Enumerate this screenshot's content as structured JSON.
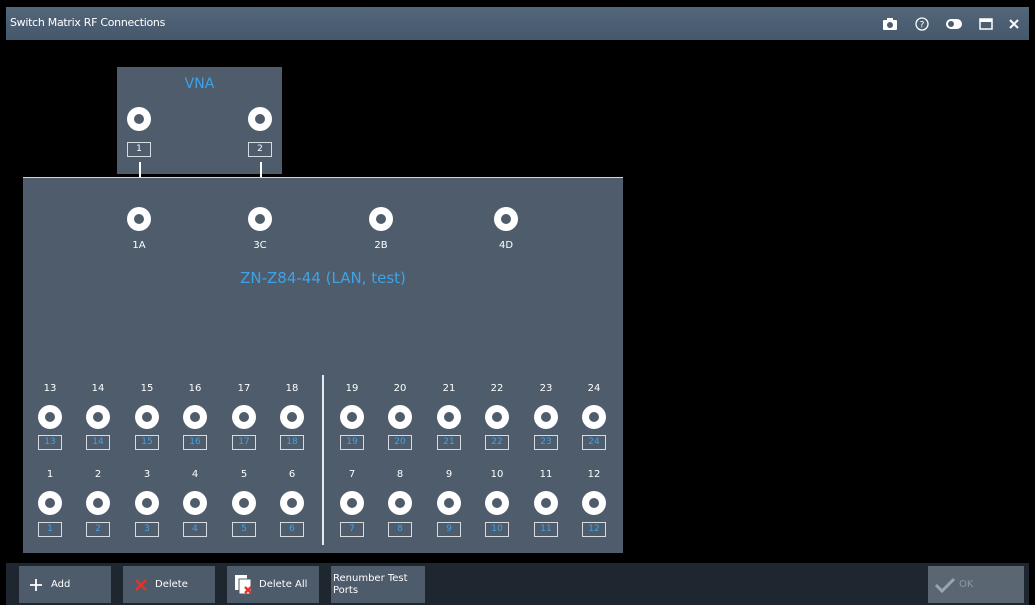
{
  "window": {
    "title": "Switch Matrix RF Connections"
  },
  "titlebar_icons": [
    "camera-icon",
    "help-icon",
    "toggle-icon",
    "maximize-icon",
    "close-icon"
  ],
  "vna": {
    "name": "VNA",
    "ports": [
      "1",
      "2"
    ]
  },
  "switch": {
    "name": "ZN-Z84-44 (LAN, test)",
    "vna_ports": [
      "1A",
      "3C",
      "2B",
      "4D"
    ],
    "top_row_numbers": [
      "13",
      "14",
      "15",
      "16",
      "17",
      "18",
      "19",
      "20",
      "21",
      "22",
      "23",
      "24"
    ],
    "top_row_ports": [
      "13",
      "14",
      "15",
      "16",
      "17",
      "18",
      "19",
      "20",
      "21",
      "22",
      "23",
      "24"
    ],
    "bottom_row_numbers": [
      "1",
      "2",
      "3",
      "4",
      "5",
      "6",
      "7",
      "8",
      "9",
      "10",
      "11",
      "12"
    ],
    "bottom_row_ports": [
      "1",
      "2",
      "3",
      "4",
      "5",
      "6",
      "7",
      "8",
      "9",
      "10",
      "11",
      "12"
    ]
  },
  "connections": [
    {
      "from": "VNA 1",
      "to": "1A"
    },
    {
      "from": "VNA 2",
      "to": "3C"
    }
  ],
  "toolbar": {
    "add_label": "Add",
    "delete_label": "Delete",
    "delete_all_label": "Delete All",
    "renumber_label_1": "Renumber Test",
    "renumber_label_2": "Ports",
    "ok_label": "OK"
  },
  "colors": {
    "accent": "#3ea3e6",
    "panel": "#4e5c6c",
    "delete_red": "#e2342b"
  }
}
